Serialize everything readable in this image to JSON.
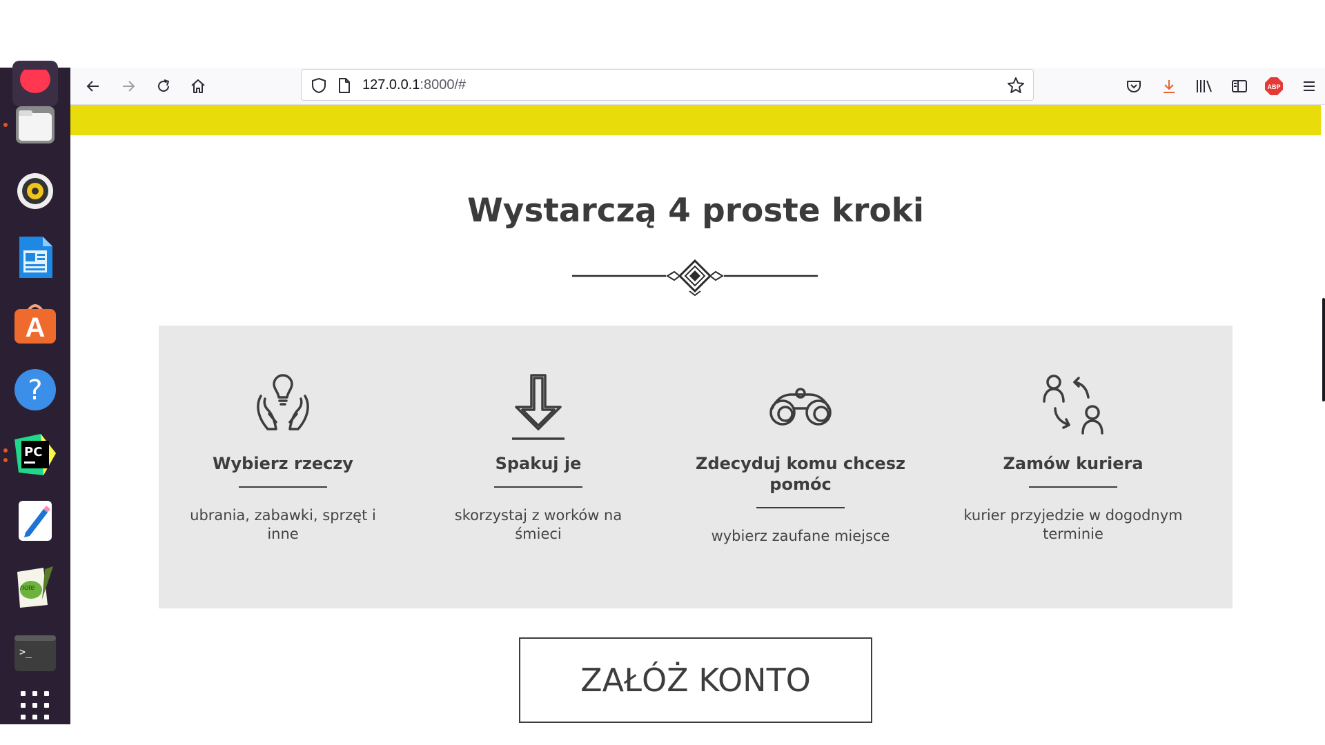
{
  "browser": {
    "url_host": "127.0.0.1",
    "url_rest": ":8000/#",
    "extension_badge": "ABP"
  },
  "dock": {
    "items": [
      "firefox-icon",
      "files-icon",
      "rhythmbox-icon",
      "writer-icon",
      "software-center-icon",
      "help-icon",
      "pycharm-icon",
      "text-editor-icon",
      "notepad-icon",
      "terminal-icon",
      "apps-grid-icon"
    ],
    "pycharm_label": "PC",
    "terminal_prompt": ">_"
  },
  "page": {
    "section_title": "Wystarczą 4 proste kroki",
    "steps": [
      {
        "icon": "hands-bulb-icon",
        "title": "Wybierz rzeczy",
        "description": "ubrania, zabawki, sprzęt i inne"
      },
      {
        "icon": "arrow-down-icon",
        "title": "Spakuj je",
        "description": "skorzystaj z worków na śmieci"
      },
      {
        "icon": "binoculars-icon",
        "title": "Zdecyduj komu chcesz pomóc",
        "description": "wybierz zaufane miejsce"
      },
      {
        "icon": "courier-exchange-icon",
        "title": "Zamów kuriera",
        "description": "kurier przyjedzie w dogodnym terminie"
      }
    ],
    "cta_label": "ZAŁÓŻ KONTO"
  },
  "colors": {
    "accent_yellow": "#e8dc0a",
    "steps_background": "#e8e8e8",
    "text_dark": "#3d3d3d",
    "dock_background": "#2b1f33"
  }
}
